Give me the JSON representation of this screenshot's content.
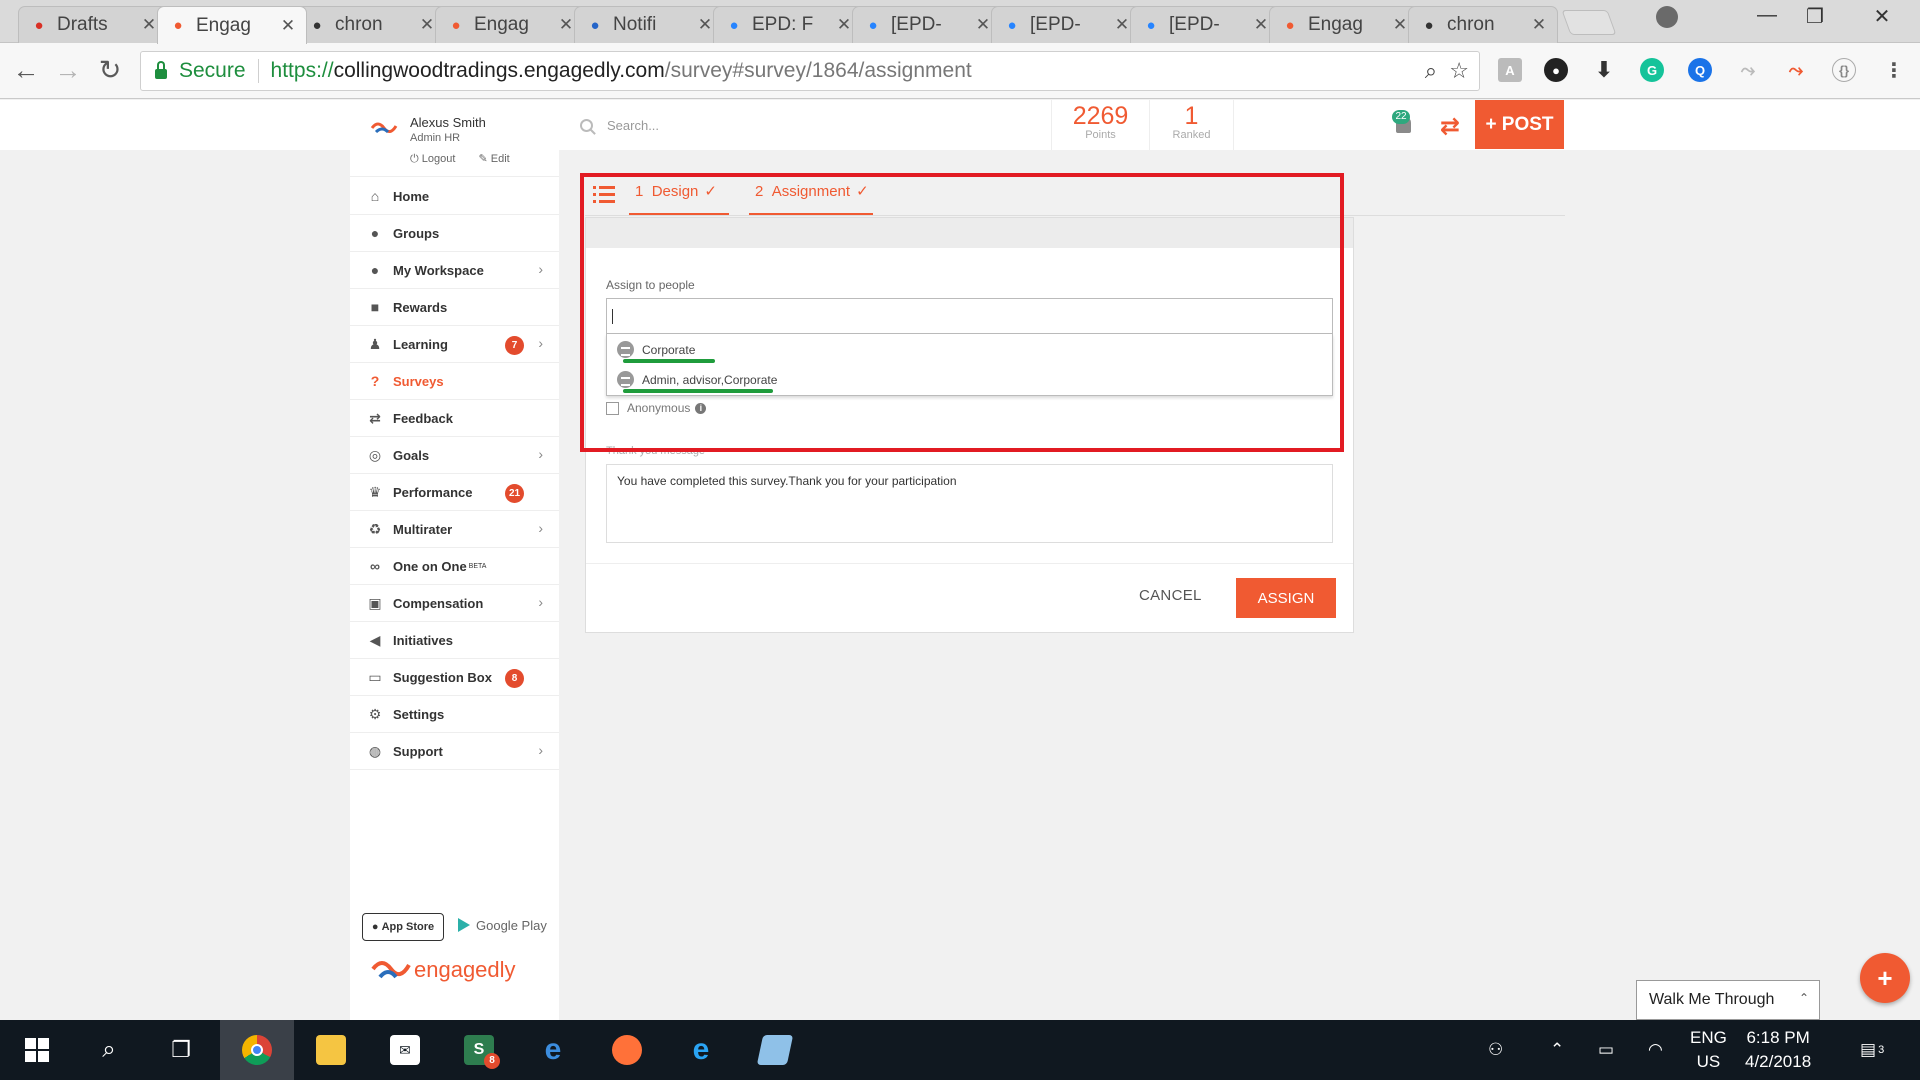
{
  "browser": {
    "tabs": [
      {
        "label": "Drafts",
        "icon": "gmail-icon",
        "color": "#d93025"
      },
      {
        "label": "Engag",
        "icon": "engagedly-icon",
        "color": "#f05a32"
      },
      {
        "label": "chron",
        "icon": "chrome-icon",
        "color": "#333333"
      },
      {
        "label": "Engag",
        "icon": "engagedly-icon",
        "color": "#f05a32"
      },
      {
        "label": "Notifi",
        "icon": "atlassian-icon",
        "color": "#2464c8"
      },
      {
        "label": "EPD: F",
        "icon": "jira-icon",
        "color": "#2684ff"
      },
      {
        "label": "[EPD-",
        "icon": "jira-icon",
        "color": "#2684ff"
      },
      {
        "label": "[EPD-",
        "icon": "jira-icon",
        "color": "#2684ff"
      },
      {
        "label": "[EPD-",
        "icon": "jira-icon",
        "color": "#2684ff"
      },
      {
        "label": "Engag",
        "icon": "engagedly-icon",
        "color": "#f05a32"
      },
      {
        "label": "chron",
        "icon": "chrome-icon",
        "color": "#333333"
      }
    ],
    "secure_label": "Secure",
    "url_scheme": "https://",
    "url_host": "collingwoodtradings.engagedly.com",
    "url_path": "/survey#survey/1864/assignment"
  },
  "header": {
    "search_placeholder": "Search...",
    "points_value": "2269",
    "points_label": "Points",
    "rank_value": "1",
    "rank_label": "Ranked",
    "notif_count": "22",
    "post_label": "+ POST"
  },
  "user": {
    "name": "Alexus Smith",
    "role": "Admin HR",
    "logout": "Logout",
    "edit": "Edit"
  },
  "menu": [
    {
      "label": "Home",
      "icon": "home-icon",
      "glyph": "⌂"
    },
    {
      "label": "Groups",
      "icon": "groups-icon",
      "glyph": "●"
    },
    {
      "label": "My Workspace",
      "icon": "user-icon",
      "glyph": "●",
      "chevron": true
    },
    {
      "label": "Rewards",
      "icon": "gift-icon",
      "glyph": "■"
    },
    {
      "label": "Learning",
      "icon": "learning-icon",
      "glyph": "♟",
      "badge": "7",
      "chevron": true
    },
    {
      "label": "Surveys",
      "icon": "question-icon",
      "glyph": "?",
      "active": true
    },
    {
      "label": "Feedback",
      "icon": "exchange-icon",
      "glyph": "⇄"
    },
    {
      "label": "Goals",
      "icon": "target-icon",
      "glyph": "◎",
      "chevron": true
    },
    {
      "label": "Performance",
      "icon": "trophy-icon",
      "glyph": "♛",
      "badge": "21"
    },
    {
      "label": "Multirater",
      "icon": "recycle-icon",
      "glyph": "♻",
      "chevron": true
    },
    {
      "label": "One on One",
      "sup": "BETA",
      "icon": "handshake-icon",
      "glyph": "∞"
    },
    {
      "label": "Compensation",
      "icon": "money-icon",
      "glyph": "▣",
      "chevron": true
    },
    {
      "label": "Initiatives",
      "icon": "bullhorn-icon",
      "glyph": "◀"
    },
    {
      "label": "Suggestion Box",
      "icon": "inbox-icon",
      "glyph": "▭",
      "badge": "8"
    },
    {
      "label": "Settings",
      "icon": "gear-icon",
      "glyph": "⚙"
    },
    {
      "label": "Support",
      "icon": "globe-icon",
      "glyph": "◍",
      "chevron": true
    }
  ],
  "stores": {
    "appstore": "App Store",
    "googleplay": "Google Play"
  },
  "brand": "engagedly",
  "wizard": {
    "step1_num": "1",
    "step1_label": "Design",
    "step2_num": "2",
    "step2_label": "Assignment",
    "check": "✓",
    "assign_label": "Assign to people",
    "options": [
      "Corporate",
      "Admin, advisor,Corporate"
    ],
    "anonymous_label": "Anonymous",
    "thankyou_label": "Thank you message",
    "thankyou_text": "You have completed this survey.Thank you for your participation",
    "cancel_label": "CANCEL",
    "assign_button": "ASSIGN"
  },
  "walkme": "Walk Me Through",
  "taskbar": {
    "lang1": "ENG",
    "lang2": "US",
    "time": "6:18 PM",
    "date": "4/2/2018",
    "notif_count": "3",
    "skype_badge": "8"
  },
  "colors": {
    "accent": "#f05a32",
    "highlight_box": "#e21b23",
    "underline": "#1f9c3c"
  }
}
